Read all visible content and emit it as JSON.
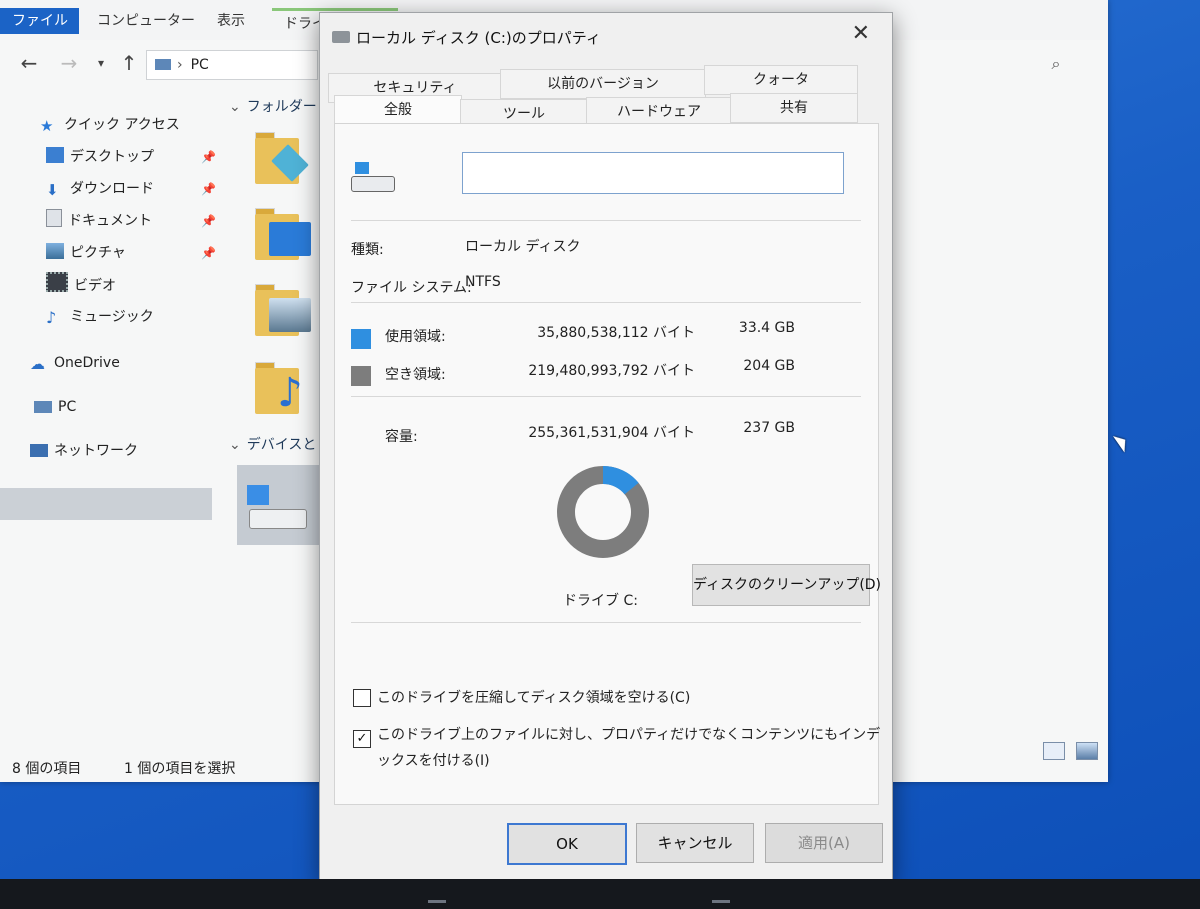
{
  "explorer": {
    "ribbon_tabs": [
      "ファイル",
      "コンピューター",
      "表示",
      "ドライブ ツール"
    ],
    "address_path": "PC",
    "sidebar": [
      {
        "label": "クイック アクセス",
        "icon": "star-icon"
      },
      {
        "label": "デスクトップ",
        "icon": "desktop-icon"
      },
      {
        "label": "ダウンロード",
        "icon": "download-icon"
      },
      {
        "label": "ドキュメント",
        "icon": "document-icon"
      },
      {
        "label": "ピクチャ",
        "icon": "picture-icon"
      },
      {
        "label": "ビデオ",
        "icon": "video-icon"
      },
      {
        "label": "ミュージック",
        "icon": "music-icon"
      },
      {
        "label": "OneDrive",
        "icon": "cloud-icon"
      },
      {
        "label": "PC",
        "icon": "pc-icon"
      },
      {
        "label": "ネットワーク",
        "icon": "network-icon"
      }
    ],
    "groups": [
      "フォルダー (",
      "デバイスとド"
    ],
    "status_count": "8 個の項目",
    "status_selected": "1 個の項目を選択"
  },
  "dialog": {
    "title": "ローカル ディスク (C:)のプロパティ",
    "tabs_top": [
      "セキュリティ",
      "以前のバージョン",
      "クォータ"
    ],
    "tabs_bottom": [
      "全般",
      "ツール",
      "ハードウェア",
      "共有"
    ],
    "name_value": "",
    "type_label": "種類:",
    "type_value": "ローカル ディスク",
    "fs_label": "ファイル システム:",
    "fs_value": "NTFS",
    "used_label": "使用領域:",
    "used_bytes": "35,880,538,112 バイト",
    "used_gb": "33.4 GB",
    "free_label": "空き領域:",
    "free_bytes": "219,480,993,792 バイト",
    "free_gb": "204 GB",
    "cap_label": "容量:",
    "cap_bytes": "255,361,531,904 バイト",
    "cap_gb": "237 GB",
    "drive_label": "ドライブ C:",
    "cleanup_button": "ディスクのクリーンアップ(D)",
    "compress_label": "このドライブを圧縮してディスク領域を空ける(C)",
    "compress_checked": false,
    "index_label_line1": "このドライブ上のファイルに対し、プロパティだけでなくコンテンツにもインデ",
    "index_label_line2": "ックスを付ける(I)",
    "index_checked": true,
    "ok_button": "OK",
    "cancel_button": "キャンセル",
    "apply_button": "適用(A)",
    "used_fraction": 0.1405,
    "colors": {
      "used": "#2f8fe0",
      "free": "#7d7d7d"
    }
  }
}
